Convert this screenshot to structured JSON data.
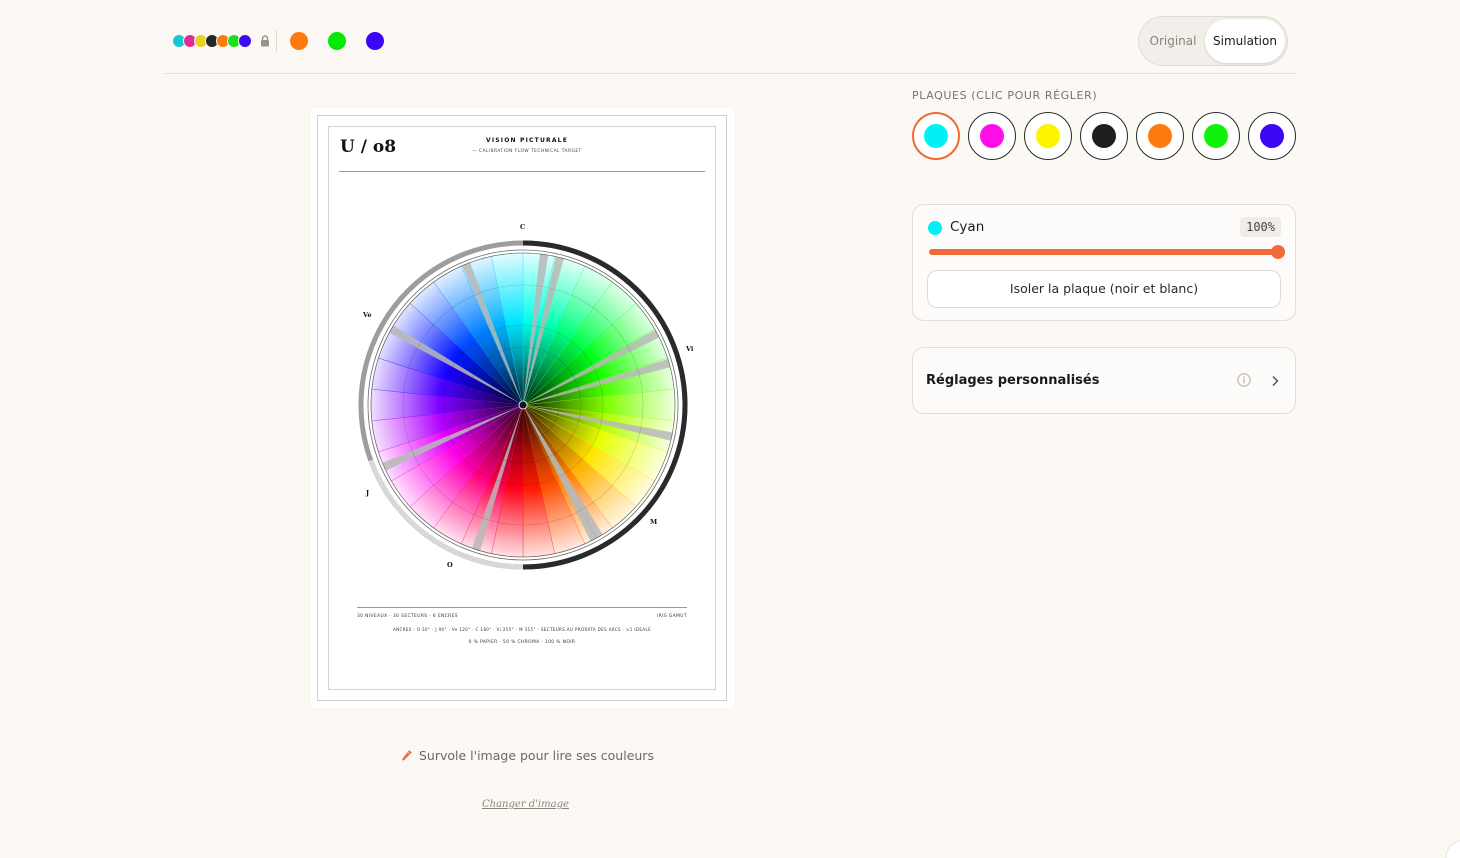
{
  "toggle": {
    "original": "Original",
    "simulation": "Simulation",
    "selected": "Simulation"
  },
  "top_inks": [
    {
      "name": "cyan",
      "color": "#15c6d4"
    },
    {
      "name": "magenta",
      "color": "#e22b9a"
    },
    {
      "name": "yellow",
      "color": "#e6d21f"
    },
    {
      "name": "black",
      "color": "#262626"
    },
    {
      "name": "orange",
      "color": "#ff7a0c"
    },
    {
      "name": "green",
      "color": "#19e01e"
    },
    {
      "name": "violet",
      "color": "#3d0bf0"
    }
  ],
  "top_extra_inks": [
    "#ff7a0c",
    "#06e806",
    "#3a06f4"
  ],
  "poster": {
    "title": "U / o8",
    "heading": "VISION PICTURALE",
    "subtitle": "— CALIBRATION FLOW TECHNICAL TARGET",
    "axis_labels": {
      "c": "C",
      "vi": "Vi",
      "m": "M",
      "o": "O",
      "j": "J",
      "ve": "Ve"
    },
    "footer_left": "30 NIVEAUX · 30 SECTEURS · 6 ENCRES",
    "footer_right": "IRIS GAMUT",
    "footer_line2": "ANCRES : O 30° · J 90° · Ve 120° · C 180° · Vi 255° · M 315° · SECTEURS AU PRORATA DES ARCS · ×1 IDEALE",
    "footer_line3": "0 % PAPIER · 50 % CHROMA · 100 % NOIR",
    "sectors": 30,
    "levels": 30
  },
  "hint": "Survole l'image pour lire ses couleurs",
  "change_image": "Changer d'image",
  "plates": {
    "label": "PLAQUES (CLIC POUR RÉGLER)",
    "items": [
      {
        "name": "cyan",
        "color": "#00f0f6",
        "selected": true
      },
      {
        "name": "magenta",
        "color": "#ff0fe7",
        "selected": false
      },
      {
        "name": "yellow",
        "color": "#fff400",
        "selected": false
      },
      {
        "name": "black",
        "color": "#1f1f21",
        "selected": false
      },
      {
        "name": "orange",
        "color": "#ff7a0c",
        "selected": false
      },
      {
        "name": "green",
        "color": "#0ff00a",
        "selected": false
      },
      {
        "name": "violet",
        "color": "#3c06f6",
        "selected": false
      }
    ]
  },
  "ink_panel": {
    "name": "Cyan",
    "percent_label": "100%",
    "value": 100,
    "color": "#00f0f6",
    "isolate_button": "Isoler la plaque (noir et blanc)"
  },
  "custom_settings": {
    "label": "Réglages personnalisés"
  },
  "colors": {
    "accent": "#f06a3a",
    "background": "#fcf9f5"
  }
}
